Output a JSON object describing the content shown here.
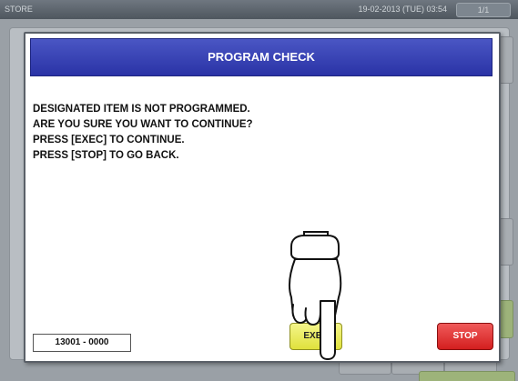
{
  "topbar": {
    "store": "STORE",
    "datetime": "19-02-2013 (TUE) 03:54",
    "page": "1/1"
  },
  "dialog": {
    "title": "PROGRAM CHECK",
    "messages": [
      "DESIGNATED ITEM IS NOT PROGRAMMED.",
      "ARE YOU SURE YOU WANT TO CONTINUE?",
      "PRESS [EXEC] TO CONTINUE.",
      "PRESS [STOP] TO GO BACK."
    ],
    "item_code": "13001 - 0000",
    "exec_label": "EXEC",
    "stop_label": "STOP"
  },
  "icons": {
    "pointer": "hand-pointer-icon"
  },
  "colors": {
    "title_bar": "#2a33a6",
    "exec_button": "#e0e13c",
    "stop_button": "#d41f1f"
  }
}
